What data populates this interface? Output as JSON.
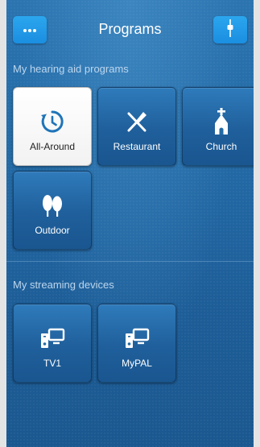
{
  "header": {
    "title": "Programs",
    "menu_button_icon": "more-dots-icon",
    "settings_button_icon": "slider-icon"
  },
  "programs": {
    "section_label": "My hearing aid programs",
    "items": [
      {
        "label": "All-Around",
        "icon": "auto-cycle-icon",
        "selected": true
      },
      {
        "label": "Restaurant",
        "icon": "fork-knife-icon",
        "selected": false
      },
      {
        "label": "Church",
        "icon": "church-icon",
        "selected": false
      },
      {
        "label": "Outdoor",
        "icon": "trees-icon",
        "selected": false
      }
    ]
  },
  "streaming": {
    "section_label": "My streaming devices",
    "items": [
      {
        "label": "TV1",
        "icon": "tv-streamer-icon"
      },
      {
        "label": "MyPAL",
        "icon": "tv-streamer-icon"
      }
    ]
  },
  "colors": {
    "accent": "#1b8ee0",
    "background": "#236aa6",
    "selected_icon": "#1f74b8"
  }
}
